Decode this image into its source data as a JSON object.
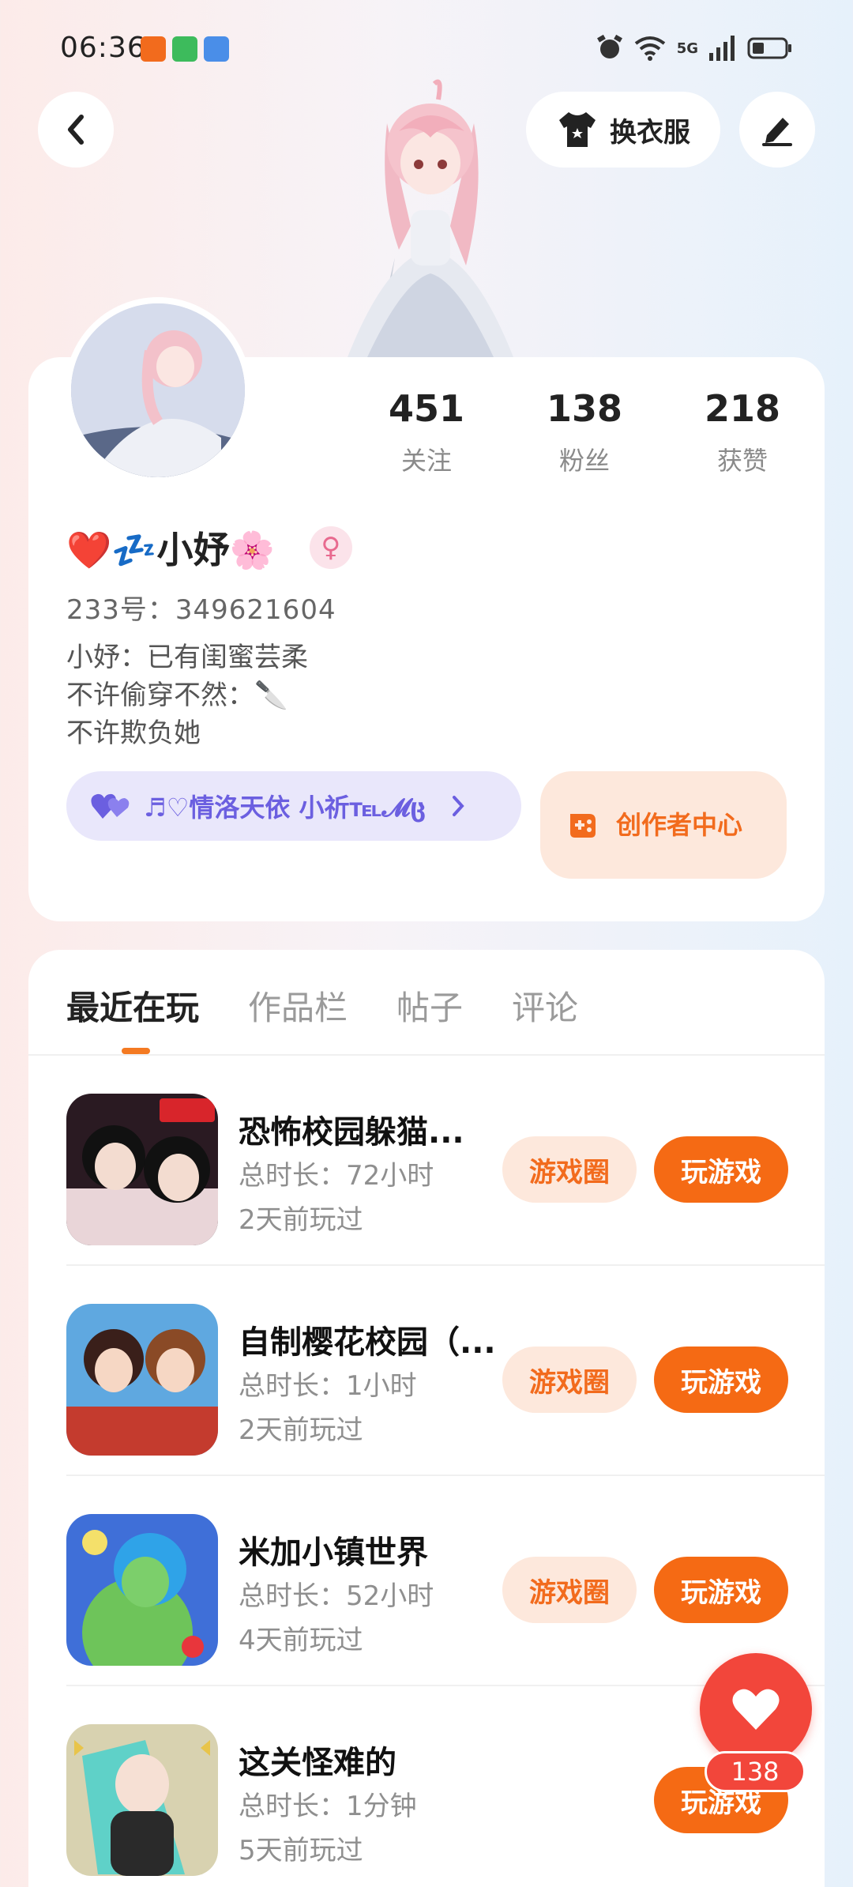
{
  "status_bar": {
    "time": "06:36",
    "network": "5G",
    "app_icons": [
      "app-icon-orange",
      "app-icon-green",
      "app-icon-blue"
    ]
  },
  "header": {
    "back_icon": "chevron-left-icon",
    "dressup_label": "换衣服",
    "dressup_icon": "shirt-icon",
    "edit_icon": "pen-icon"
  },
  "profile": {
    "stats": [
      {
        "value": "451",
        "label": "关注"
      },
      {
        "value": "138",
        "label": "粉丝"
      },
      {
        "value": "218",
        "label": "获赞"
      }
    ],
    "username": "❤️💤小妤🌸",
    "gender_symbol": "♀",
    "uid": "233号：349621604",
    "bio_lines": [
      "小妤：已有闺蜜芸柔",
      "不许偷穿不然：🔪",
      "不许欺负她"
    ],
    "relation": {
      "text": "♬♡情洛天依   小祈℡𝓜ც",
      "icon": "hearts-icon"
    },
    "creator_center": {
      "label": "创作者中心",
      "icon": "gamepad-icon"
    }
  },
  "tabs": [
    {
      "label": "最近在玩",
      "active": true
    },
    {
      "label": "作品栏",
      "active": false
    },
    {
      "label": "帖子",
      "active": false
    },
    {
      "label": "评论",
      "active": false
    }
  ],
  "games": [
    {
      "title": "恐怖校园躲猫...",
      "duration": "总时长：72小时",
      "last_played": "2天前玩过",
      "circle_label": "游戏圈",
      "play_label": "玩游戏",
      "thumb_colors": [
        "#2a1a22",
        "#8b2b3a"
      ]
    },
    {
      "title": "自制樱花校园（...",
      "duration": "总时长：1小时",
      "last_played": "2天前玩过",
      "circle_label": "游戏圈",
      "play_label": "玩游戏",
      "thumb_colors": [
        "#5fa8e0",
        "#c43b2e"
      ]
    },
    {
      "title": "米加小镇世界",
      "duration": "总时长：52小时",
      "last_played": "4天前玩过",
      "circle_label": "游戏圈",
      "play_label": "玩游戏",
      "thumb_colors": [
        "#3f6fd8",
        "#6ec45a"
      ]
    },
    {
      "title": "这关怪难的",
      "duration": "总时长：1分钟",
      "last_played": "5天前玩过",
      "circle_label": "",
      "play_label": "玩游戏",
      "thumb_colors": [
        "#d8d2b0",
        "#2a2a2a"
      ]
    }
  ],
  "like_fab": {
    "count": "138",
    "icon": "heart-icon"
  },
  "colors": {
    "accent": "#f56a14",
    "accent_light": "#fde8dc",
    "relation_purple": "#6b5fe0",
    "like_red": "#f2463b"
  }
}
